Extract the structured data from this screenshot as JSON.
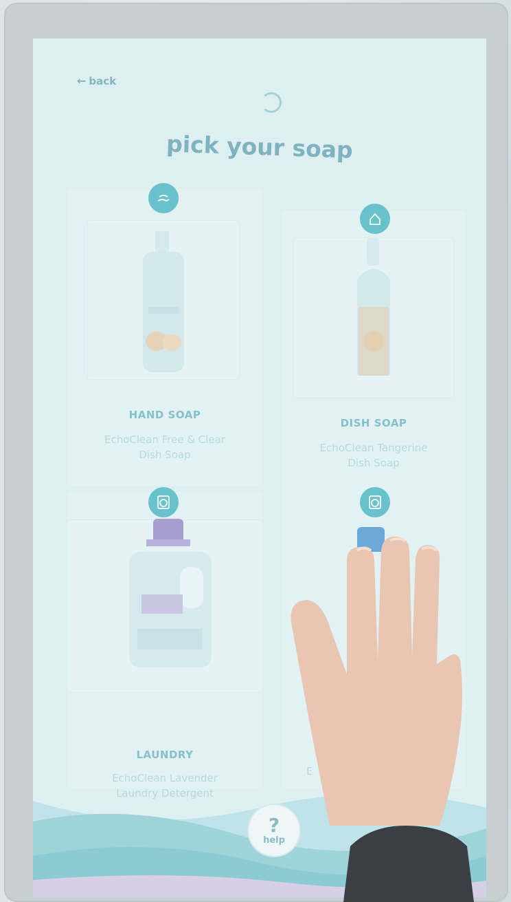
{
  "nav": {
    "back_label": "back"
  },
  "page": {
    "title": "pick your soap"
  },
  "products": [
    {
      "category": "HAND SOAP",
      "name": "EchoClean Free & Clear Dish Soap",
      "icon": "hand-wash-icon"
    },
    {
      "category": "DISH SOAP",
      "name": "EchoClean Tangerine Dish Soap",
      "icon": "dish-icon"
    },
    {
      "category": "LAUNDRY",
      "name": "EchoClean Lavender Laundry Detergent",
      "icon": "washing-machine-icon"
    },
    {
      "category": "",
      "name": "E",
      "icon": "washing-machine-icon"
    }
  ],
  "help": {
    "label": "help",
    "glyph": "?"
  },
  "colors": {
    "accent": "#69c2cb",
    "title": "#7eb3bf",
    "screen": "#ddeff1"
  }
}
